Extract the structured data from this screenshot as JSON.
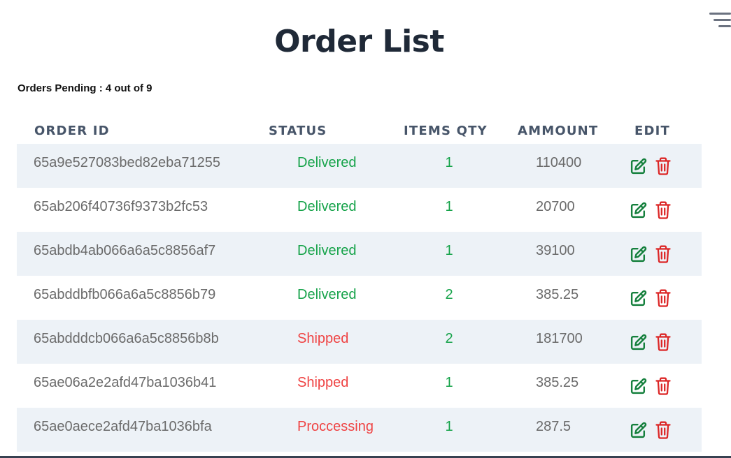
{
  "page": {
    "title": "Order List",
    "menu_icon": "filter-lines-icon"
  },
  "summary": {
    "pending_text": "Orders Pending : 4 out of 9"
  },
  "table": {
    "headers": {
      "order_id": "ORDER ID",
      "status": "STATUS",
      "items_qty": "ITEMS QTY",
      "amount": "AMMOUNT",
      "edit": "EDIT"
    },
    "rows": [
      {
        "id": "65a9e527083bed82eba71255",
        "status": "Delivered",
        "qty": "1",
        "amount": "110400"
      },
      {
        "id": "65ab206f40736f9373b2fc53",
        "status": "Delivered",
        "qty": "1",
        "amount": "20700"
      },
      {
        "id": "65abdb4ab066a6a5c8856af7",
        "status": "Delivered",
        "qty": "1",
        "amount": "39100"
      },
      {
        "id": "65abddbfb066a6a5c8856b79",
        "status": "Delivered",
        "qty": "2",
        "amount": "385.25"
      },
      {
        "id": "65abdddcb066a6a5c8856b8b",
        "status": "Shipped",
        "qty": "2",
        "amount": "181700"
      },
      {
        "id": "65ae06a2e2afd47ba1036b41",
        "status": "Shipped",
        "qty": "1",
        "amount": "385.25"
      },
      {
        "id": "65ae0aece2afd47ba1036bfa",
        "status": "Proccessing",
        "qty": "1",
        "amount": "287.5"
      }
    ]
  },
  "icons": {
    "edit": "edit-icon",
    "delete": "trash-icon"
  },
  "colors": {
    "delivered": "#16a34a",
    "pending_status": "#ef4444",
    "edit_icon": "#15803d",
    "delete_icon": "#dc2626",
    "row_stripe": "#edf2f7",
    "header_text": "#475569"
  }
}
